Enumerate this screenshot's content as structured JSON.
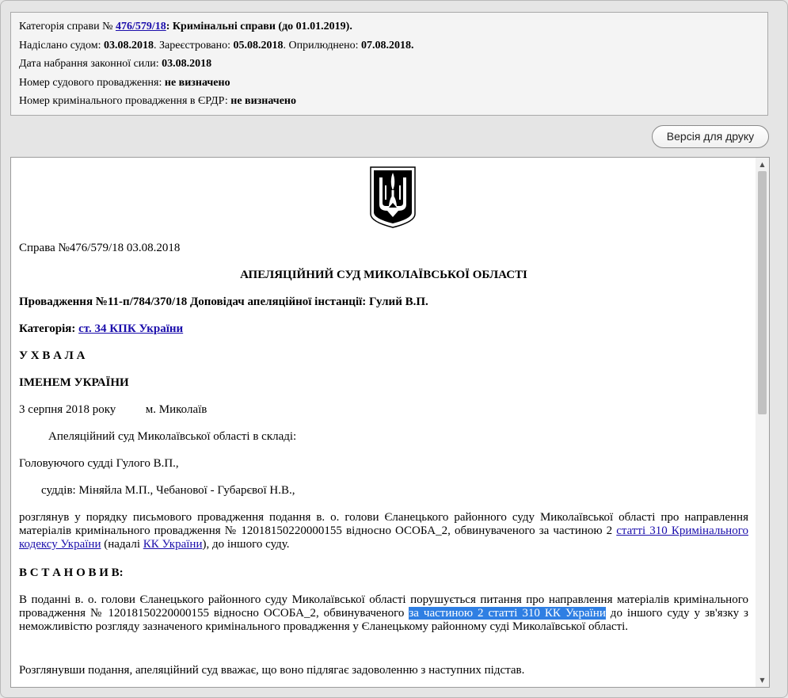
{
  "info": {
    "category_label": "Категорія справи № ",
    "case_link": "476/579/18",
    "category_value": ": Кримінальні справи (до 01.01.2019).",
    "sent_label": "Надіслано судом: ",
    "sent_date": "03.08.2018",
    "registered_label": ". Зареєстровано: ",
    "registered_date": "05.08.2018",
    "published_label": ". Оприлюднено: ",
    "published_date": "07.08.2018.",
    "effective_label": "Дата набрання законної сили: ",
    "effective_date": "03.08.2018",
    "court_proc_label": "Номер судового провадження: ",
    "court_proc_value": "не визначено",
    "criminal_proc_label": "Номер кримінального провадження в ЄРДР: ",
    "criminal_proc_value": "не визначено"
  },
  "toolbar": {
    "print_label": "Версія для друку"
  },
  "doc": {
    "case_line": "Справа №476/579/18 03.08.2018",
    "court_title": "АПЕЛЯЦІЙНИЙ СУД МИКОЛАЇВСЬКОЇ ОБЛАСТІ",
    "proceeding_line": "Провадження №11-п/784/370/18 Доповідач апеляційної інстанції: Гулий В.П.",
    "category_label": "Категорія: ",
    "category_link": "ст. 34 КПК України",
    "ruling": "У Х В А Л А",
    "in_name": "ІМЕНЕМ УКРАЇНИ",
    "date_place": "3 серпня 2018 року          м. Миколаїв",
    "composition": "Апеляційний суд Миколаївської області в складі:",
    "presiding": "Головуючого судді Гулого В.П.,",
    "judges": "суддів: Міняйла М.П., Чебанової - Губарєвої Н.В.,",
    "considered_text": "розглянув у порядку письмового провадження подання в. о. голови Єланецького районного суду Миколаївської області про направлення матеріалів кримінального провадження № 12018150220000155 відносно ОСОБА_2, обвинуваченого за частиною 2 ",
    "considered_link1": "статті 310 Кримінального кодексу України",
    "considered_mid": " (надалі ",
    "considered_link2": "КК України",
    "considered_end": "), до іншого суду.",
    "established": "В С Т А Н О В И В:",
    "submission_start": "В поданні в. о. голови Єланецького районного суду Миколаївської області порушується питання про направлення матеріалів кримінального провадження № 12018150220000155 відносно ОСОБА_2, обвинуваченого ",
    "submission_highlight": "за частиною 2 статті 310 КК України",
    "submission_end": " до іншого суду у зв'язку з неможливістю розгляду зазначеного кримінального провадження у Єланецькому районному суді Миколаївської області.",
    "considering": "Розглянувши подання, апеляційний суд вважає, що воно підлягає задоволенню з наступних підстав."
  },
  "icons": {
    "coat_of_arms": "trident-emblem-icon",
    "scroll_up": "arrow-up-icon",
    "scroll_down": "arrow-down-icon"
  }
}
